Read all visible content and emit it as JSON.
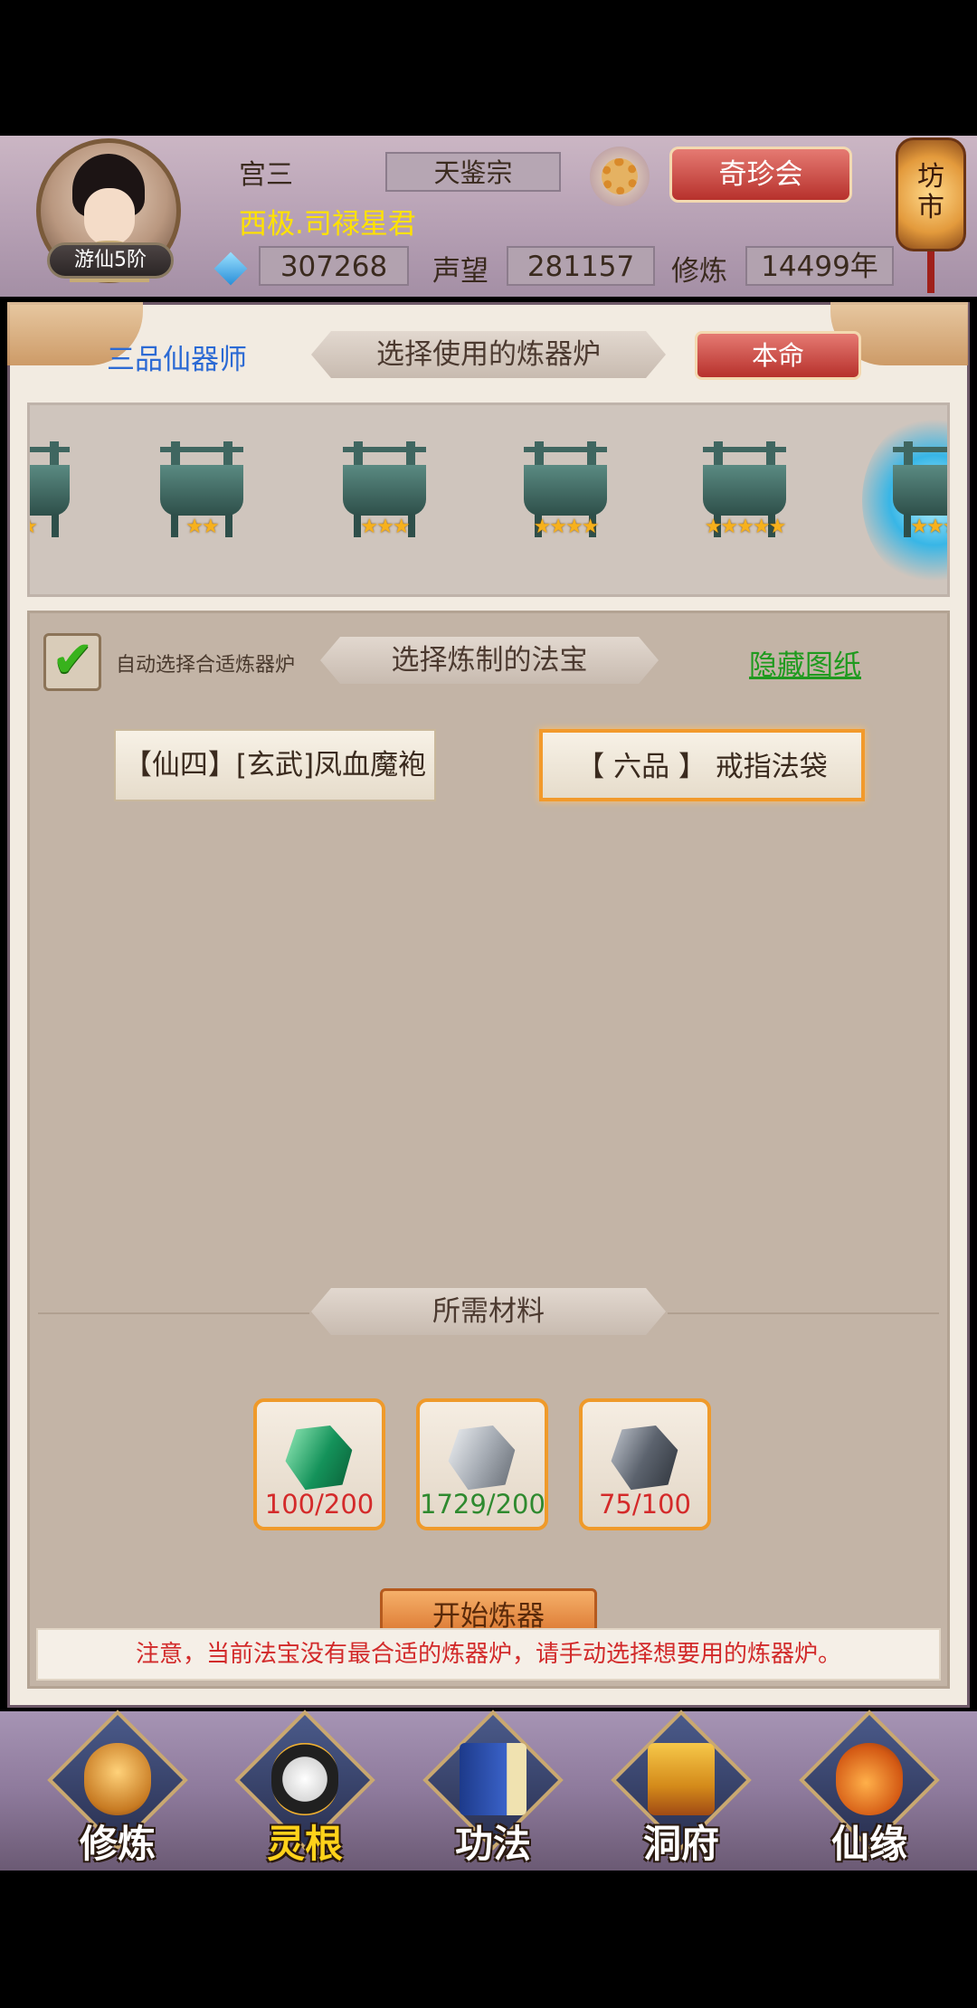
{
  "player": {
    "name": "宫三",
    "rank": "游仙5阶",
    "sect": "天鉴宗",
    "title": "西极.司禄星君",
    "spirit_stones": "307268",
    "reputation_label": "声望",
    "reputation": "281157",
    "cultivation_label": "修炼",
    "cultivation": "14499年"
  },
  "header": {
    "qizhen_button": "奇珍会",
    "market_lantern": "坊市"
  },
  "furnace_section": {
    "craft_level": "三品仙器师",
    "title": "选择使用的炼器炉",
    "benming_button": "本命",
    "furnaces": [
      {
        "stars": "★"
      },
      {
        "stars": "★★"
      },
      {
        "stars": "★★★"
      },
      {
        "stars": "★★★★"
      },
      {
        "stars": "★★★★★"
      },
      {
        "stars": "★★★"
      }
    ]
  },
  "recipe_section": {
    "auto_select_label": "自动选择合适炼器炉",
    "auto_select_checked": true,
    "title": "选择炼制的法宝",
    "hide_link": "隐藏图纸",
    "recipes": [
      {
        "label": "【仙四】[玄武]凤血魔袍",
        "selected": false
      },
      {
        "label": "【 六品 】 戒指法袋",
        "selected": true
      }
    ]
  },
  "materials_section": {
    "title": "所需材料",
    "items": [
      {
        "icon": "green-gem-icon",
        "count": "100/200",
        "count_color": "#d42a2a"
      },
      {
        "icon": "silver-ore-icon",
        "count": "1729/200",
        "count_color": "#2f8a2f"
      },
      {
        "icon": "dark-ore-icon",
        "count": "75/100",
        "count_color": "#d42a2a"
      }
    ]
  },
  "start_button": "开始炼器",
  "notice": "注意，当前法宝没有最合适的炼器炉，请手动选择想要用的炼器炉。",
  "bottom_nav": [
    {
      "label": "修炼",
      "icon": "cultivation-icon",
      "active": false
    },
    {
      "label": "灵根",
      "icon": "spirit-root-icon",
      "active": true
    },
    {
      "label": "功法",
      "icon": "technique-book-icon",
      "active": false
    },
    {
      "label": "洞府",
      "icon": "cave-abode-icon",
      "active": false
    },
    {
      "label": "仙缘",
      "icon": "immortal-fate-icon",
      "active": false
    }
  ],
  "colors": {
    "accent_red": "#c0392b",
    "link_green": "#1f9a1f",
    "title_yellow": "#ffe200",
    "warning_red": "#d22a2a"
  }
}
